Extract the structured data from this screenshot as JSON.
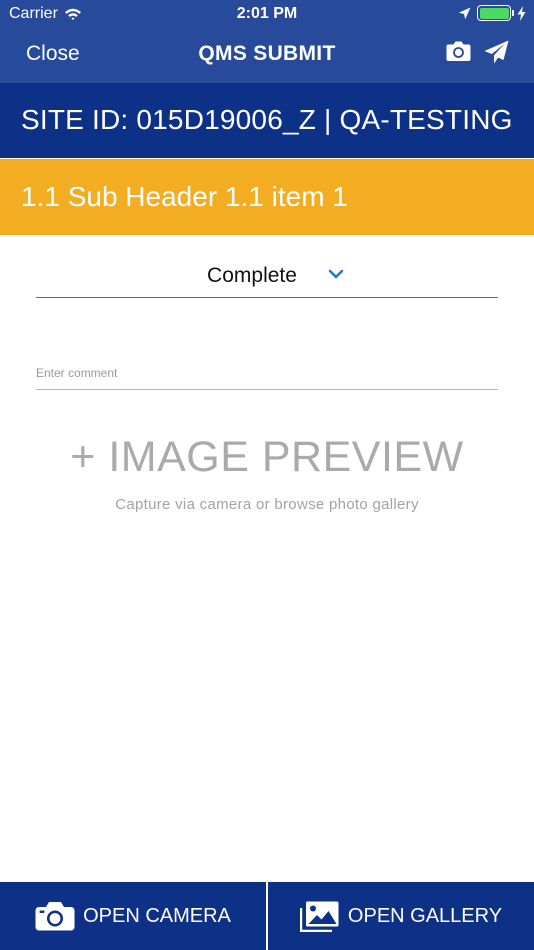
{
  "status_bar": {
    "carrier": "Carrier",
    "time": "2:01 PM",
    "battery_percent": 100,
    "icons": [
      "wifi-icon",
      "location-arrow-icon",
      "battery-icon",
      "charging-bolt-icon"
    ]
  },
  "nav": {
    "close_label": "Close",
    "title": "QMS SUBMIT",
    "icons": [
      "camera-icon",
      "send-icon"
    ]
  },
  "site_header": {
    "text": "SITE ID: 015D19006_Z | QA-TESTING"
  },
  "sub_header": {
    "text": "1.1 Sub Header 1.1 item 1"
  },
  "status_select": {
    "value": "Complete",
    "icon": "chevron-down-icon"
  },
  "comment": {
    "placeholder": "Enter comment",
    "value": ""
  },
  "preview": {
    "title": "+ IMAGE PREVIEW",
    "subtitle": "Capture via camera or browse photo gallery"
  },
  "bottom": {
    "camera_label": "OPEN CAMERA",
    "gallery_label": "OPEN GALLERY",
    "icons": [
      "camera-icon",
      "gallery-icon"
    ]
  },
  "colors": {
    "nav_bg": "#274a9b",
    "header_bg": "#0e3188",
    "accent_orange": "#f2ad23",
    "chevron_blue": "#1e78d9",
    "battery_green": "#4cd964"
  }
}
